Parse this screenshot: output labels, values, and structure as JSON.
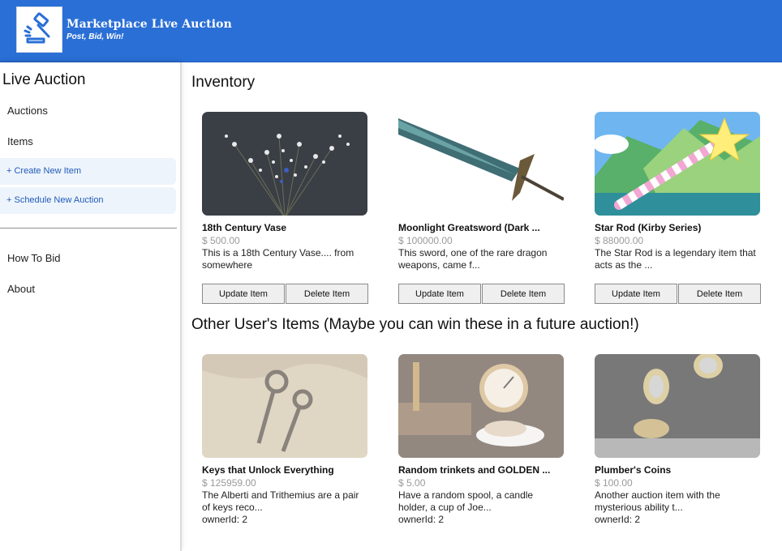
{
  "header": {
    "title": "Marketplace Live Auction",
    "tagline": "Post, Bid, Win!",
    "logo_icon": "gavel-icon",
    "brand_color": "#2a6fd6"
  },
  "sidebar": {
    "title": "Live Auction",
    "links": [
      "Auctions",
      "Items"
    ],
    "actions": [
      "+ Create New Item",
      "+ Schedule New Auction"
    ],
    "bottom_links": [
      "How To Bid",
      "About"
    ]
  },
  "inventory": {
    "title": "Inventory",
    "update_label": "Update Item",
    "delete_label": "Delete Item",
    "items": [
      {
        "name": "18th Century Vase",
        "price": "$ 500.00",
        "desc": "This is a 18th Century Vase.... from somewhere"
      },
      {
        "name": "Moonlight Greatsword (Dark ...",
        "price": "$ 100000.00",
        "desc": "This sword, one of the rare dragon weapons, came f..."
      },
      {
        "name": "Star Rod (Kirby Series)",
        "price": "$ 88000.00",
        "desc": "The Star Rod is a legendary item that acts as the ..."
      }
    ]
  },
  "others": {
    "title": "Other User's Items (Maybe you can win these in a future auction!)",
    "items": [
      {
        "name": "Keys that Unlock Everything",
        "price": "$ 125959.00",
        "desc": "The Alberti and Trithemius are a pair of keys reco...",
        "owner": "ownerId: 2"
      },
      {
        "name": "Random trinkets and GOLDEN ...",
        "price": "$ 5.00",
        "desc": "Have a random spool, a candle holder, a cup of Joe...",
        "owner": "ownerId: 2"
      },
      {
        "name": "Plumber's Coins",
        "price": "$ 100.00",
        "desc": "Another auction item with the mysterious ability t...",
        "owner": "ownerId: 2"
      }
    ]
  }
}
